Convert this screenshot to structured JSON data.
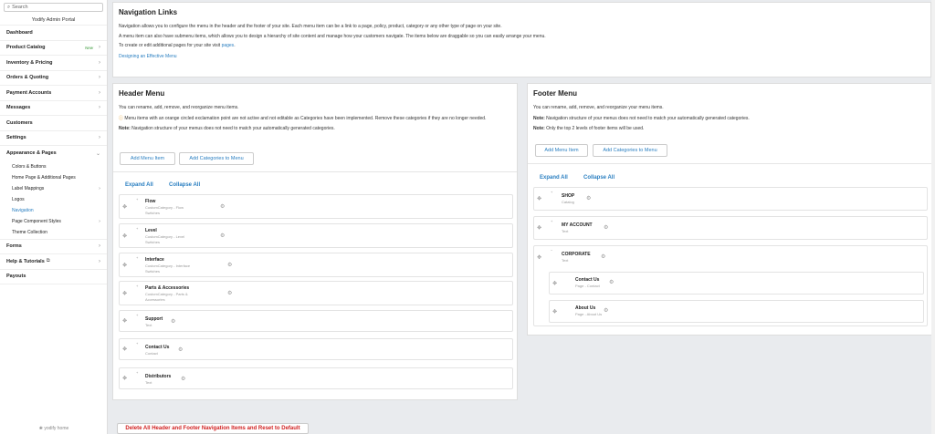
{
  "sidebar": {
    "search_placeholder": "Search",
    "portal_title": "Yodify Admin Portal",
    "items": [
      {
        "label": "Dashboard"
      },
      {
        "label": "Product Catalog",
        "badge": "New"
      },
      {
        "label": "Inventory & Pricing"
      },
      {
        "label": "Orders & Quoting"
      },
      {
        "label": "Payment Accounts"
      },
      {
        "label": "Messages"
      },
      {
        "label": "Customers"
      },
      {
        "label": "Settings"
      },
      {
        "label": "Appearance & Pages"
      },
      {
        "label": "Forms"
      },
      {
        "label": "Help & Tutorials"
      },
      {
        "label": "Payouts"
      }
    ],
    "subitems": [
      {
        "label": "Colors & Buttons"
      },
      {
        "label": "Home Page & Additional Pages"
      },
      {
        "label": "Label Mappings"
      },
      {
        "label": "Logos"
      },
      {
        "label": "Navigation"
      },
      {
        "label": "Page Component Styles"
      },
      {
        "label": "Theme Collection"
      }
    ],
    "footer_logo": "yodify home"
  },
  "intro": {
    "title": "Navigation Links",
    "p1": "Navigation allows you to configure the menu in the header and the footer of your site. Each menu item can be a link to a page, policy, product, category or any other type of page on your site.",
    "p2": "A menu item can also have submenu items, which allows you to design a hierarchy of site content and manage how your customers navigate. The items below are draggable so you can easily arrange your menu.",
    "p3_prefix": "To create or edit additional pages for your site visit",
    "p3_link": "pages",
    "p3_suffix": ".",
    "design_link": "Designing an Effective Menu"
  },
  "header_menu": {
    "title": "Header Menu",
    "p1": "You can rename, add, remove, and reorganize menu items.",
    "warning": "Menu items with an orange circled exclamation point are not active and not editable as Categories have been implemented. Remove these categories if they are no longer needed.",
    "note_label": "Note:",
    "note": "Navigation structure of your menus does not need to match your automatically generated categories.",
    "add_item": "Add Menu Item",
    "add_categories": "Add Categories to Menu",
    "expand": "Expand All",
    "collapse": "Collapse All",
    "items": [
      {
        "title": "Flow",
        "sub1": "CustomCategory - Flow",
        "sub2": "Switches"
      },
      {
        "title": "Level",
        "sub1": "CustomCategory - Level",
        "sub2": "Switches"
      },
      {
        "title": "Interface",
        "sub1": "CustomCategory - Interface",
        "sub2": "Switches"
      },
      {
        "title": "Parts & Accessories",
        "sub1": "CustomCategory - Parts &",
        "sub2": "Accessories"
      },
      {
        "title": "Support",
        "sub1": "Text",
        "sub2": ""
      },
      {
        "title": "Contact Us",
        "sub1": "Contact",
        "sub2": ""
      },
      {
        "title": "Distributors",
        "sub1": "Text",
        "sub2": ""
      }
    ]
  },
  "footer_menu": {
    "title": "Footer Menu",
    "p1": "You can rename, add, remove, and reorganize your menu items.",
    "note_label": "Note:",
    "note": "Navigation structure of your menus does not need to match your automatically generated categories.",
    "note2": "Only the top 2 levels of footer items will be used.",
    "add_item": "Add Menu Item",
    "add_categories": "Add Categories to Menu",
    "expand": "Expand All",
    "collapse": "Collapse All",
    "items": [
      {
        "title": "SHOP",
        "sub": "Catalog"
      },
      {
        "title": "MY ACCOUNT",
        "sub": "Text"
      },
      {
        "title": "CORPORATE",
        "sub": "Text"
      },
      {
        "title": "Contact Us",
        "sub": "Page - Contact"
      },
      {
        "title": "About Us",
        "sub": "Page - About Us"
      }
    ]
  },
  "delete_button": "Delete All Header and Footer Navigation Items and Reset to Default"
}
